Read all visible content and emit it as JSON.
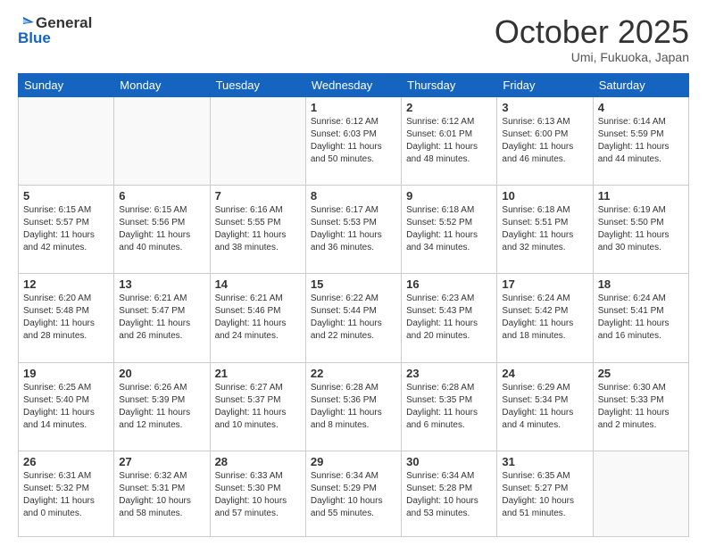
{
  "logo": {
    "line1": "General",
    "line2": "Blue"
  },
  "title": "October 2025",
  "location": "Umi, Fukuoka, Japan",
  "days_of_week": [
    "Sunday",
    "Monday",
    "Tuesday",
    "Wednesday",
    "Thursday",
    "Friday",
    "Saturday"
  ],
  "weeks": [
    [
      {
        "day": "",
        "content": ""
      },
      {
        "day": "",
        "content": ""
      },
      {
        "day": "",
        "content": ""
      },
      {
        "day": "1",
        "content": "Sunrise: 6:12 AM\nSunset: 6:03 PM\nDaylight: 11 hours\nand 50 minutes."
      },
      {
        "day": "2",
        "content": "Sunrise: 6:12 AM\nSunset: 6:01 PM\nDaylight: 11 hours\nand 48 minutes."
      },
      {
        "day": "3",
        "content": "Sunrise: 6:13 AM\nSunset: 6:00 PM\nDaylight: 11 hours\nand 46 minutes."
      },
      {
        "day": "4",
        "content": "Sunrise: 6:14 AM\nSunset: 5:59 PM\nDaylight: 11 hours\nand 44 minutes."
      }
    ],
    [
      {
        "day": "5",
        "content": "Sunrise: 6:15 AM\nSunset: 5:57 PM\nDaylight: 11 hours\nand 42 minutes."
      },
      {
        "day": "6",
        "content": "Sunrise: 6:15 AM\nSunset: 5:56 PM\nDaylight: 11 hours\nand 40 minutes."
      },
      {
        "day": "7",
        "content": "Sunrise: 6:16 AM\nSunset: 5:55 PM\nDaylight: 11 hours\nand 38 minutes."
      },
      {
        "day": "8",
        "content": "Sunrise: 6:17 AM\nSunset: 5:53 PM\nDaylight: 11 hours\nand 36 minutes."
      },
      {
        "day": "9",
        "content": "Sunrise: 6:18 AM\nSunset: 5:52 PM\nDaylight: 11 hours\nand 34 minutes."
      },
      {
        "day": "10",
        "content": "Sunrise: 6:18 AM\nSunset: 5:51 PM\nDaylight: 11 hours\nand 32 minutes."
      },
      {
        "day": "11",
        "content": "Sunrise: 6:19 AM\nSunset: 5:50 PM\nDaylight: 11 hours\nand 30 minutes."
      }
    ],
    [
      {
        "day": "12",
        "content": "Sunrise: 6:20 AM\nSunset: 5:48 PM\nDaylight: 11 hours\nand 28 minutes."
      },
      {
        "day": "13",
        "content": "Sunrise: 6:21 AM\nSunset: 5:47 PM\nDaylight: 11 hours\nand 26 minutes."
      },
      {
        "day": "14",
        "content": "Sunrise: 6:21 AM\nSunset: 5:46 PM\nDaylight: 11 hours\nand 24 minutes."
      },
      {
        "day": "15",
        "content": "Sunrise: 6:22 AM\nSunset: 5:44 PM\nDaylight: 11 hours\nand 22 minutes."
      },
      {
        "day": "16",
        "content": "Sunrise: 6:23 AM\nSunset: 5:43 PM\nDaylight: 11 hours\nand 20 minutes."
      },
      {
        "day": "17",
        "content": "Sunrise: 6:24 AM\nSunset: 5:42 PM\nDaylight: 11 hours\nand 18 minutes."
      },
      {
        "day": "18",
        "content": "Sunrise: 6:24 AM\nSunset: 5:41 PM\nDaylight: 11 hours\nand 16 minutes."
      }
    ],
    [
      {
        "day": "19",
        "content": "Sunrise: 6:25 AM\nSunset: 5:40 PM\nDaylight: 11 hours\nand 14 minutes."
      },
      {
        "day": "20",
        "content": "Sunrise: 6:26 AM\nSunset: 5:39 PM\nDaylight: 11 hours\nand 12 minutes."
      },
      {
        "day": "21",
        "content": "Sunrise: 6:27 AM\nSunset: 5:37 PM\nDaylight: 11 hours\nand 10 minutes."
      },
      {
        "day": "22",
        "content": "Sunrise: 6:28 AM\nSunset: 5:36 PM\nDaylight: 11 hours\nand 8 minutes."
      },
      {
        "day": "23",
        "content": "Sunrise: 6:28 AM\nSunset: 5:35 PM\nDaylight: 11 hours\nand 6 minutes."
      },
      {
        "day": "24",
        "content": "Sunrise: 6:29 AM\nSunset: 5:34 PM\nDaylight: 11 hours\nand 4 minutes."
      },
      {
        "day": "25",
        "content": "Sunrise: 6:30 AM\nSunset: 5:33 PM\nDaylight: 11 hours\nand 2 minutes."
      }
    ],
    [
      {
        "day": "26",
        "content": "Sunrise: 6:31 AM\nSunset: 5:32 PM\nDaylight: 11 hours\nand 0 minutes."
      },
      {
        "day": "27",
        "content": "Sunrise: 6:32 AM\nSunset: 5:31 PM\nDaylight: 10 hours\nand 58 minutes."
      },
      {
        "day": "28",
        "content": "Sunrise: 6:33 AM\nSunset: 5:30 PM\nDaylight: 10 hours\nand 57 minutes."
      },
      {
        "day": "29",
        "content": "Sunrise: 6:34 AM\nSunset: 5:29 PM\nDaylight: 10 hours\nand 55 minutes."
      },
      {
        "day": "30",
        "content": "Sunrise: 6:34 AM\nSunset: 5:28 PM\nDaylight: 10 hours\nand 53 minutes."
      },
      {
        "day": "31",
        "content": "Sunrise: 6:35 AM\nSunset: 5:27 PM\nDaylight: 10 hours\nand 51 minutes."
      },
      {
        "day": "",
        "content": ""
      }
    ]
  ]
}
